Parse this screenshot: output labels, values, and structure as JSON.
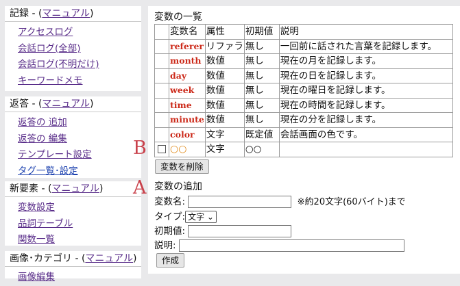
{
  "sidebar": {
    "sections": [
      {
        "title": "記録 - (",
        "manual": "マニュアル",
        "close": ")",
        "items": [
          "アクセスログ",
          "会話ログ(全部)",
          "会話ログ(不明だけ)",
          "キーワードメモ"
        ]
      },
      {
        "title": "返答 - (",
        "manual": "マニュアル",
        "close": ")",
        "items": [
          "返答の 追加",
          "返答の 編集",
          "テンプレート設定",
          "タグ一覧･設定"
        ]
      },
      {
        "title": "新要素 - (",
        "manual": "マニュアル",
        "close": ")",
        "items": [
          "変数設定",
          "品詞テーブル",
          "関数一覧"
        ]
      },
      {
        "title": "画像･カテゴリ - (",
        "manual": "マニュアル",
        "close": ")",
        "items": [
          "画像編集"
        ]
      }
    ]
  },
  "annotations": {
    "b": "B",
    "a": "A"
  },
  "variables": {
    "title": "変数の一覧",
    "headers": [
      "変数名",
      "属性",
      "初期値",
      "説明"
    ],
    "rows": [
      {
        "name": "referer",
        "type": "リファラ",
        "initial": "無し",
        "desc": "一回前に話された言葉を記録します。"
      },
      {
        "name": "month",
        "type": "数値",
        "initial": "無し",
        "desc": "現在の月を記録します。"
      },
      {
        "name": "day",
        "type": "数値",
        "initial": "無し",
        "desc": "現在の日を記録します。"
      },
      {
        "name": "week",
        "type": "数値",
        "initial": "無し",
        "desc": "現在の曜日を記録します。"
      },
      {
        "name": "time",
        "type": "数値",
        "initial": "無し",
        "desc": "現在の時間を記録します。"
      },
      {
        "name": "minute",
        "type": "数値",
        "initial": "無し",
        "desc": "現在の分を記録します。"
      },
      {
        "name": "color",
        "type": "文字",
        "initial": "既定値",
        "desc": "会話画面の色です。"
      },
      {
        "name": "○○",
        "type": "文字",
        "initial": "○○",
        "desc": ""
      }
    ],
    "delete_button": "変数を削除"
  },
  "add": {
    "title": "変数の追加",
    "name_label": "変数名:",
    "name_hint": "※約20文字(60バイト)まで",
    "type_label": "タイプ:",
    "type_value": "文字",
    "initial_label": "初期値:",
    "desc_label": "説明:",
    "create_button": "作成"
  }
}
